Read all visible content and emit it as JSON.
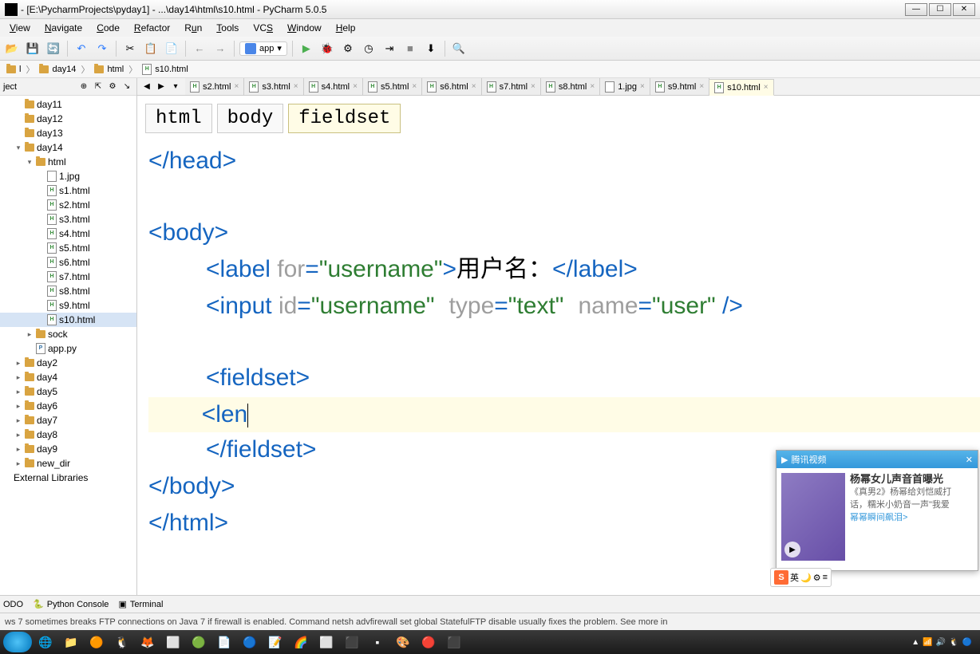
{
  "window": {
    "title": "- [E:\\PycharmProjects\\pyday1] - ...\\day14\\html\\s10.html - PyCharm 5.0.5"
  },
  "menus": [
    "View",
    "Navigate",
    "Code",
    "Refactor",
    "Run",
    "Tools",
    "VCS",
    "Window",
    "Help"
  ],
  "run_config": "app",
  "breadcrumbs": [
    {
      "icon": "folder",
      "text": "l"
    },
    {
      "icon": "folder",
      "text": "day14"
    },
    {
      "icon": "folder",
      "text": "html"
    },
    {
      "icon": "file-h",
      "text": "s10.html"
    }
  ],
  "sidebar": {
    "header": "ject",
    "tree": [
      {
        "depth": 0,
        "arrow": "",
        "icon": "folder",
        "text": "day11"
      },
      {
        "depth": 0,
        "arrow": "",
        "icon": "folder",
        "text": "day12"
      },
      {
        "depth": 0,
        "arrow": "",
        "icon": "folder",
        "text": "day13"
      },
      {
        "depth": 0,
        "arrow": "▾",
        "icon": "folder",
        "text": "day14"
      },
      {
        "depth": 1,
        "arrow": "▾",
        "icon": "folder",
        "text": "html"
      },
      {
        "depth": 2,
        "arrow": "",
        "icon": "file-img",
        "text": "1.jpg"
      },
      {
        "depth": 2,
        "arrow": "",
        "icon": "file-h",
        "text": "s1.html"
      },
      {
        "depth": 2,
        "arrow": "",
        "icon": "file-h",
        "text": "s2.html"
      },
      {
        "depth": 2,
        "arrow": "",
        "icon": "file-h",
        "text": "s3.html"
      },
      {
        "depth": 2,
        "arrow": "",
        "icon": "file-h",
        "text": "s4.html"
      },
      {
        "depth": 2,
        "arrow": "",
        "icon": "file-h",
        "text": "s5.html"
      },
      {
        "depth": 2,
        "arrow": "",
        "icon": "file-h",
        "text": "s6.html"
      },
      {
        "depth": 2,
        "arrow": "",
        "icon": "file-h",
        "text": "s7.html"
      },
      {
        "depth": 2,
        "arrow": "",
        "icon": "file-h",
        "text": "s8.html"
      },
      {
        "depth": 2,
        "arrow": "",
        "icon": "file-h",
        "text": "s9.html"
      },
      {
        "depth": 2,
        "arrow": "",
        "icon": "file-h",
        "text": "s10.html",
        "selected": true
      },
      {
        "depth": 1,
        "arrow": "▸",
        "icon": "folder",
        "text": "sock"
      },
      {
        "depth": 1,
        "arrow": "",
        "icon": "file-py",
        "text": "app.py"
      },
      {
        "depth": 0,
        "arrow": "▸",
        "icon": "folder",
        "text": "day2"
      },
      {
        "depth": 0,
        "arrow": "▸",
        "icon": "folder",
        "text": "day4"
      },
      {
        "depth": 0,
        "arrow": "▸",
        "icon": "folder",
        "text": "day5"
      },
      {
        "depth": 0,
        "arrow": "▸",
        "icon": "folder",
        "text": "day6"
      },
      {
        "depth": 0,
        "arrow": "▸",
        "icon": "folder",
        "text": "day7"
      },
      {
        "depth": 0,
        "arrow": "▸",
        "icon": "folder",
        "text": "day8"
      },
      {
        "depth": 0,
        "arrow": "▸",
        "icon": "folder",
        "text": "day9"
      },
      {
        "depth": 0,
        "arrow": "▸",
        "icon": "folder",
        "text": "new_dir"
      },
      {
        "depth": -1,
        "arrow": "",
        "icon": "",
        "text": "External Libraries"
      }
    ]
  },
  "tabs": [
    {
      "icon": "file-h",
      "text": "s2.html",
      "active": false
    },
    {
      "icon": "file-h",
      "text": "s3.html",
      "active": false
    },
    {
      "icon": "file-h",
      "text": "s4.html",
      "active": false
    },
    {
      "icon": "file-h",
      "text": "s5.html",
      "active": false
    },
    {
      "icon": "file-h",
      "text": "s6.html",
      "active": false
    },
    {
      "icon": "file-h",
      "text": "s7.html",
      "active": false
    },
    {
      "icon": "file-h",
      "text": "s8.html",
      "active": false
    },
    {
      "icon": "file-img",
      "text": "1.jpg",
      "active": false
    },
    {
      "icon": "file-h",
      "text": "s9.html",
      "active": false
    },
    {
      "icon": "file-h",
      "text": "s10.html",
      "active": true
    }
  ],
  "path_crumbs": [
    "html",
    "body",
    "fieldset"
  ],
  "code": {
    "line1": "</head>",
    "line2": "<body>",
    "label_open": "<label ",
    "label_for_attr": "for",
    "label_for_val": "\"username\"",
    "label_text": "用户名：",
    "label_close": "</label>",
    "input_open": "<input ",
    "input_id_attr": "id",
    "input_id_val": "\"username\"",
    "input_type_attr": "type",
    "input_type_val": "\"text\"",
    "input_name_attr": "name",
    "input_name_val": "\"user\"",
    "input_close": " />",
    "fieldset_open": "<fieldset>",
    "len_partial": "<len",
    "fieldset_close": "</fieldset>",
    "body_close": "</body>",
    "html_close": "</html>"
  },
  "bottom_tabs": [
    "ODO",
    "Python Console",
    "Terminal"
  ],
  "status": "ws 7 sometimes breaks FTP connections on Java 7 if firewall is enabled. Command netsh advfirewall set global StatefulFTP disable usually fixes the problem. See more in",
  "popup": {
    "header": "腾讯视频",
    "title": "杨幂女儿声音首曝光",
    "sub1": "《真男2》杨幂给刘恺威打",
    "sub2": "话，糯米小奶音一声\"我爱",
    "link": "幂幂瞬间飙泪>"
  },
  "ime": "英"
}
